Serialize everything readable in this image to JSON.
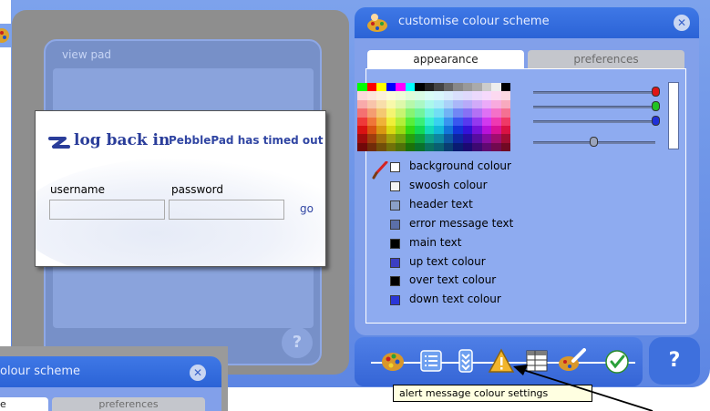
{
  "view_pad": {
    "title": "view pad",
    "help": "?"
  },
  "login": {
    "title": "log back in",
    "subtitle": "PebblePad has timed out",
    "username_label": "username",
    "password_label": "password",
    "username_value": "",
    "password_value": "",
    "go_label": "go"
  },
  "customise": {
    "title": "customise colour scheme",
    "close": "✕",
    "tabs": [
      "appearance",
      "preferences"
    ],
    "active_tab": "appearance",
    "items": [
      {
        "label": "background colour",
        "color": "#ffffff"
      },
      {
        "label": "swoosh colour",
        "color": "#f4f4f4"
      },
      {
        "label": "header text",
        "color": "#8aa0c8"
      },
      {
        "label": "error message text",
        "color": "#5b6fa8"
      },
      {
        "label": "main text",
        "color": "#000000"
      },
      {
        "label": "up text colour",
        "color": "#3b3ec2"
      },
      {
        "label": "over text colour",
        "color": "#000000"
      },
      {
        "label": "down text colour",
        "color": "#2a36d8"
      }
    ],
    "sliders": [
      {
        "name": "red",
        "color": "#e01515",
        "level": 1.0
      },
      {
        "name": "green",
        "color": "#22c222",
        "level": 1.0
      },
      {
        "name": "blue",
        "color": "#2030d8",
        "level": 1.0
      },
      {
        "name": "brightness",
        "color": "#9aa4bc",
        "level": 0.5
      }
    ],
    "help": "?"
  },
  "toolbar": {
    "icons": [
      "palette-icon",
      "list-icon",
      "scroll-icon",
      "alert-icon",
      "table-icon",
      "brush-palette-icon",
      "confirm-icon"
    ]
  },
  "tooltip": {
    "text": "alert message colour settings"
  },
  "mini_dialog": {
    "title": "olour scheme",
    "tab_active": "e",
    "tab_other": "preferences",
    "close": "✕"
  },
  "colors": {
    "accent": "#2b63d6",
    "panel": "#82a0ea",
    "frame": "#7da2ec"
  }
}
